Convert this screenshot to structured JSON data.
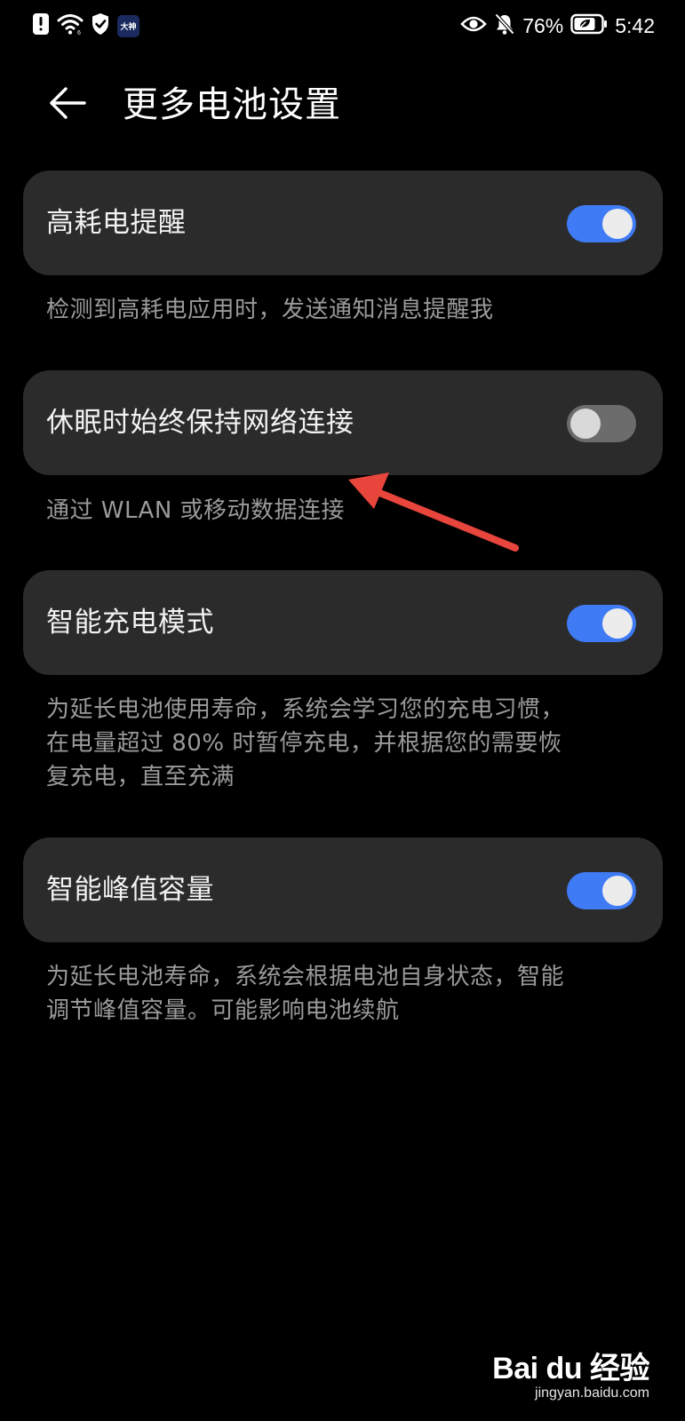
{
  "status_bar": {
    "battery_percent": "76%",
    "time": "5:42",
    "app_badge": "大神",
    "icons": [
      "notification-alert-icon",
      "wifi-icon",
      "shield-check-icon",
      "eye-icon",
      "bell-off-icon",
      "battery-leaf-icon"
    ]
  },
  "header": {
    "title": "更多电池设置",
    "back_icon": "arrow-left-icon"
  },
  "settings": [
    {
      "label": "高耗电提醒",
      "enabled": true,
      "description": "检测到高耗电应用时，发送通知消息提醒我"
    },
    {
      "label": "休眠时始终保持网络连接",
      "enabled": false,
      "description": "通过 WLAN 或移动数据连接"
    },
    {
      "label": "智能充电模式",
      "enabled": true,
      "description_lines": [
        "为延长电池使用寿命，系统会学习您的充电习惯，",
        "在电量超过 80% 时暂停充电，并根据您的需要恢",
        "复充电，直至充满"
      ]
    },
    {
      "label": "智能峰值容量",
      "enabled": true,
      "description_lines": [
        "为延长电池寿命，系统会根据电池自身状态，智能",
        "调节峰值容量。可能影响电池续航"
      ]
    }
  ],
  "colors": {
    "background": "#000000",
    "card": "#2b2b2b",
    "toggle_on": "#3f7bf4",
    "toggle_off": "#6c6c6c",
    "description_text": "#9a9a9a",
    "annotation_arrow": "#e8453c"
  },
  "watermark": {
    "logo": "Bai du 经验",
    "url": "jingyan.baidu.com"
  }
}
